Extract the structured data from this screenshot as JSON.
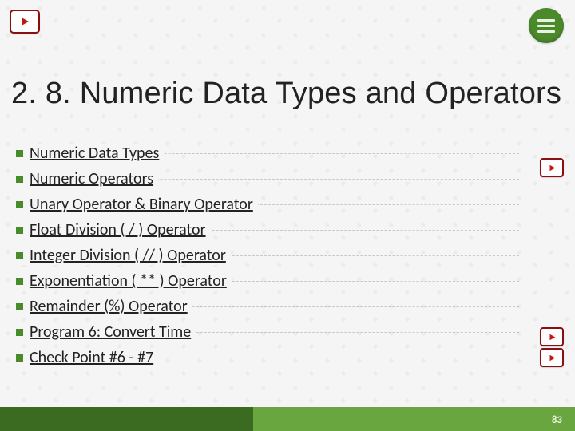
{
  "title": "2. 8. Numeric Data Types and Operators",
  "items": [
    "Numeric Data Types",
    "Numeric Operators",
    "Unary Operator & Binary Operator",
    "Float Division ( / ) Operator",
    "Integer Division ( // ) Operator",
    "Exponentiation ( ** ) Operator",
    "Remainder (%) Operator",
    "Program 6: Convert Time",
    "Check Point #6 - #7"
  ],
  "side_icon_tops": [
    198,
    410,
    436
  ],
  "page_number": "83",
  "colors": {
    "accent_green": "#4b8a2b",
    "footer_dark": "#3a6b20",
    "footer_light": "#6aa63f",
    "play_border": "#8a0f0f"
  }
}
